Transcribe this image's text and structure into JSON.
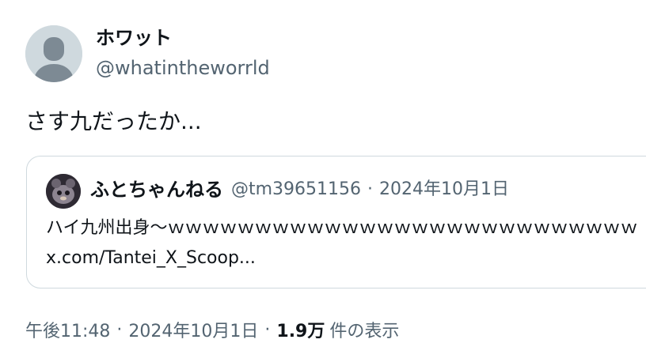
{
  "tweet": {
    "author": {
      "display_name": "ホワット",
      "handle": "@whatintheworrld",
      "avatar_icon": "default-profile-icon"
    },
    "text": "さす九だったか...",
    "quoted": {
      "author_name": "ふとちゃんねる",
      "author_handle": "@tm39651156",
      "separator": "·",
      "date": "2024年10月1日",
      "text_line_1": "ハイ九州出身〜ｗｗｗｗｗｗｗｗｗｗｗｗｗｗｗｗｗｗｗｗｗｗｗｗｗｗｗ",
      "text_line_2": "x.com/Tantei_X_Scoop..."
    },
    "meta": {
      "time": "午後11:48",
      "separator": "·",
      "date": "2024年10月1日",
      "views_count": "1.9万",
      "views_label": "件の表示"
    }
  },
  "colors": {
    "text_primary": "#0f1419",
    "text_secondary": "#536471",
    "border": "#cfd9de",
    "avatar_bg": "#cfd9de"
  }
}
